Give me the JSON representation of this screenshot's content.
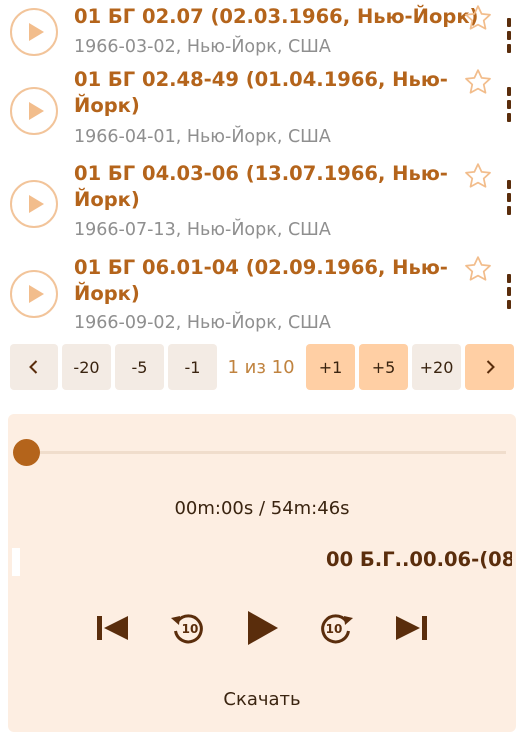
{
  "tracks": [
    {
      "title": "01 БГ 02.07 (02.03.1966, Нью-Йорк)",
      "subtitle": "1966-03-02, Нью-Йорк, США"
    },
    {
      "title": "01 БГ 02.48-49 (01.04.1966, Нью-Йорк)",
      "subtitle": "1966-04-01, Нью-Йорк, США"
    },
    {
      "title": "01 БГ 04.03-06 (13.07.1966, Нью-Йорк)",
      "subtitle": "1966-07-13, Нью-Йорк, США"
    },
    {
      "title": "01 БГ 06.01-04 (02.09.1966, Нью-Йорк)",
      "subtitle": "1966-09-02, Нью-Йорк, США"
    }
  ],
  "pager": {
    "back20": "-20",
    "back5": "-5",
    "back1": "-1",
    "info": "1 из 10",
    "fwd1": "+1",
    "fwd5": "+5",
    "fwd20": "+20"
  },
  "player": {
    "time": "00m:00s / 54m:46s",
    "progress": 0,
    "now_playing": "00 Б.Г..00.06-(08",
    "rewind_seconds": "10",
    "forward_seconds": "10",
    "download_label": "Скачать"
  },
  "colors": {
    "accent": "#b4641b",
    "dark_brown": "#5a2d0c",
    "orange_button": "#ffcfa4",
    "grey_button": "#f3ebe4",
    "player_bg": "#fdeee2"
  }
}
